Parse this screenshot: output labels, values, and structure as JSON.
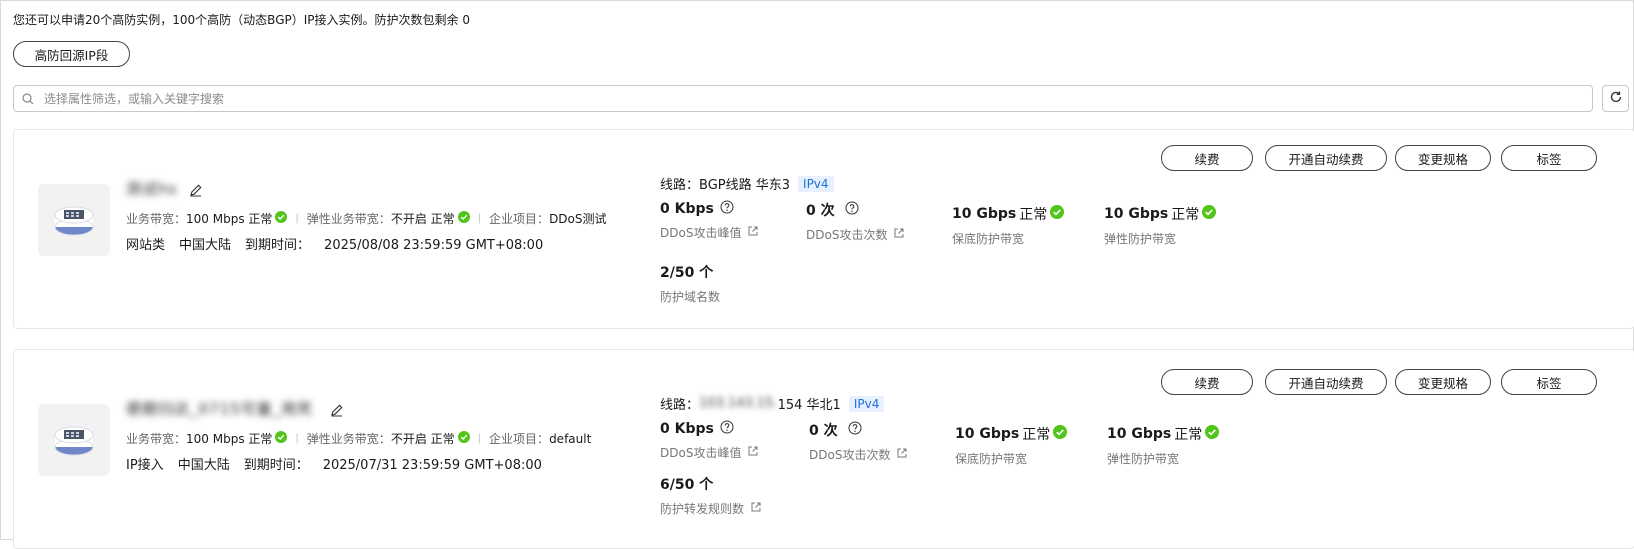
{
  "notice": "您还可以申请20个高防实例，100个高防（动态BGP）IP接入实例。防护次数包剩余 0",
  "source_ip_button": "高防回源IP段",
  "search": {
    "placeholder": "选择属性筛选，或输入关键字搜索"
  },
  "icons": {
    "search": "search-icon",
    "refresh": "refresh-icon",
    "edit": "edit-icon",
    "ok": "check-circle-icon",
    "help": "question-circle-icon",
    "external": "external-link-icon",
    "logo": "instance-logo-icon"
  },
  "colors": {
    "ok_green": "#52c41a",
    "ipv4_bg": "#e6f0ff",
    "ipv4_text": "#1f6fd6"
  },
  "actions": {
    "renew": "续费",
    "auto_renew": "开通自动续费",
    "change_spec": "变更规格",
    "tags": "标签"
  },
  "labels": {
    "biz_bandwidth": "业务带宽：",
    "elastic_biz_bandwidth": "弹性业务带宽：",
    "enterprise_project": "企业项目：",
    "expire": "到期时间：",
    "line": "线路：",
    "ddos_peak": "DDoS攻击峰值",
    "ddos_count": "DDoS攻击次数",
    "base_bw": "保底防护带宽",
    "elastic_bw": "弹性防护带宽"
  },
  "instances": [
    {
      "name": "测试hs",
      "biz_bandwidth": "100 Mbps",
      "biz_status": "正常",
      "elastic_value": "不开启",
      "elastic_status": "正常",
      "project": "DDoS测试",
      "type": "网站类",
      "region": "中国大陆",
      "expire": "2025/08/08 23:59:59 GMT+08:00",
      "line_prefix": "",
      "line_value": "BGP线路 华东3",
      "ip_version": "IPv4",
      "ddos_peak": "0 Kbps",
      "ddos_count": "0 次",
      "base_bw_value": "10 Gbps",
      "base_bw_status": "正常",
      "elastic_bw_value": "10 Gbps",
      "elastic_bw_status": "正常",
      "extra_value": "2/50 个",
      "extra_label": "防护域名数"
    },
    {
      "name": "德期归达_0715可量_用死",
      "biz_bandwidth": "100 Mbps",
      "biz_status": "正常",
      "elastic_value": "不开启",
      "elastic_status": "正常",
      "project": "default",
      "type": "IP接入",
      "region": "中国大陆",
      "expire": "2025/07/31 23:59:59 GMT+08:00",
      "line_prefix": "103.143.15.",
      "line_value": "154 华北1",
      "ip_version": "IPv4",
      "ddos_peak": "0 Kbps",
      "ddos_count": "0 次",
      "base_bw_value": "10 Gbps",
      "base_bw_status": "正常",
      "elastic_bw_value": "10 Gbps",
      "elastic_bw_status": "正常",
      "extra_value": "6/50 个",
      "extra_label": "防护转发规则数"
    }
  ]
}
